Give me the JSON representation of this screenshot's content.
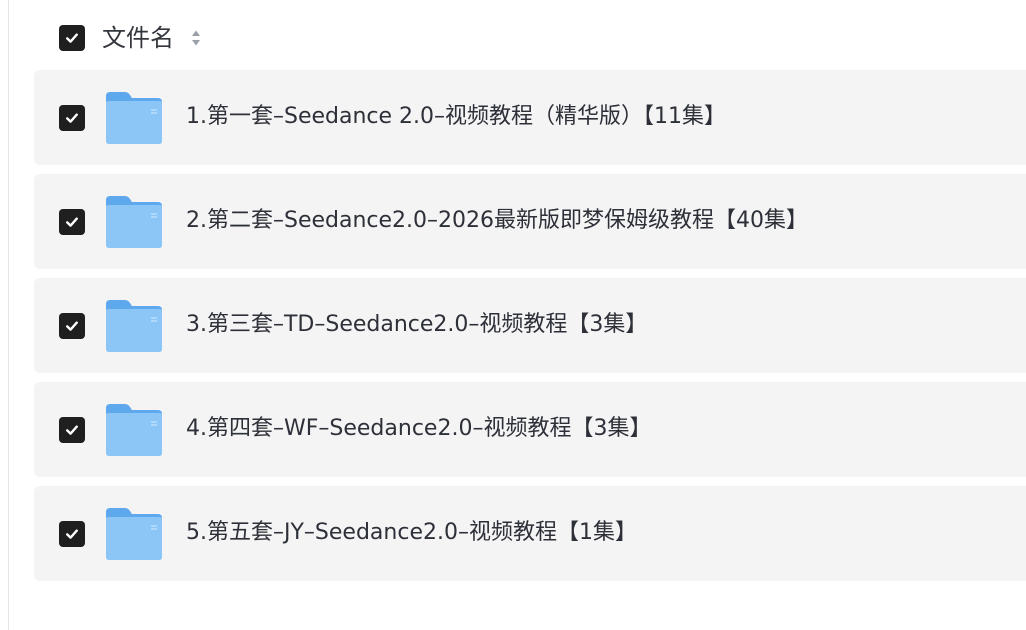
{
  "header": {
    "column_label": "文件名",
    "select_all_checked": true
  },
  "files": [
    {
      "name": "1.第一套–Seedance 2.0–视频教程（精华版）【11集】",
      "type": "folder",
      "checked": true
    },
    {
      "name": "2.第二套–Seedance2.0–2026最新版即梦保姆级教程【40集】",
      "type": "folder",
      "checked": true
    },
    {
      "name": "3.第三套–TD–Seedance2.0–视频教程【3集】",
      "type": "folder",
      "checked": true
    },
    {
      "name": "4.第四套–WF–Seedance2.0–视频教程【3集】",
      "type": "folder",
      "checked": true
    },
    {
      "name": "5.第五套–JY–Seedance2.0–视频教程【1集】",
      "type": "folder",
      "checked": true
    }
  ],
  "colors": {
    "row_background": "#f4f4f5",
    "checkbox_fill": "#1f1f1f",
    "folder_blue": "#7fbdf5",
    "text": "#2d3038"
  },
  "icons": {
    "checkbox": "checkmark-icon",
    "folder": "folder-icon",
    "sort": "sort-icon"
  }
}
